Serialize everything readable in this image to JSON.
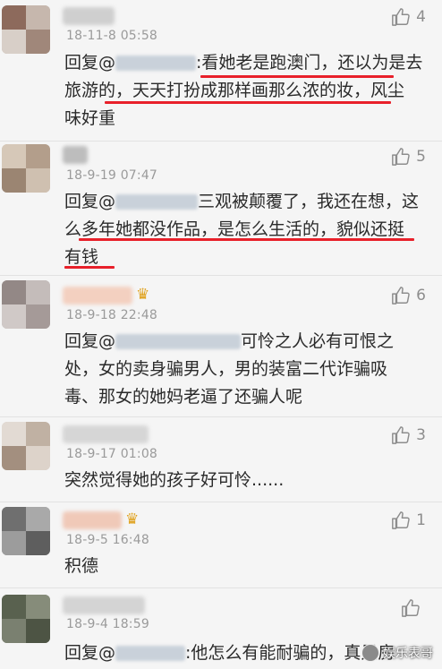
{
  "colors": {
    "underline": "#e8202a",
    "date": "#9a9a9a",
    "vip": "#e0a21e"
  },
  "comments": [
    {
      "date": "18-11-8 05:58",
      "likes": "4",
      "lines": [
        "回复@",
        ":看她老是跑澳门，还以为是去",
        "旅游的，天天打扮成那样画那么浓的妆，风尘",
        "味好重"
      ]
    },
    {
      "date": "18-9-19 07:47",
      "likes": "5",
      "lines": [
        "回复@",
        "三观被颠覆了，我还在想，这",
        "么多年她都没作品，是怎么生活的，貌似还挺",
        "有钱"
      ]
    },
    {
      "date": "18-9-18 22:48",
      "likes": "6",
      "lines": [
        "回复@",
        "可怜之人必有可恨之",
        "处，女的卖身骗男人，男的装富二代诈骗吸",
        "毒、那女的她妈老逼了还骗人呢"
      ]
    },
    {
      "date": "18-9-17 01:08",
      "likes": "3",
      "lines": [
        "突然觉得她的孩子好可怜......"
      ]
    },
    {
      "date": "18-9-5 16:48",
      "likes": "1",
      "lines": [
        "积德"
      ]
    },
    {
      "date": "18-9-4 18:59",
      "likes": "",
      "lines": [
        "回复@",
        ":他怎么有能耐骗的，真是房"
      ]
    }
  ],
  "watermark": "娱乐表哥"
}
